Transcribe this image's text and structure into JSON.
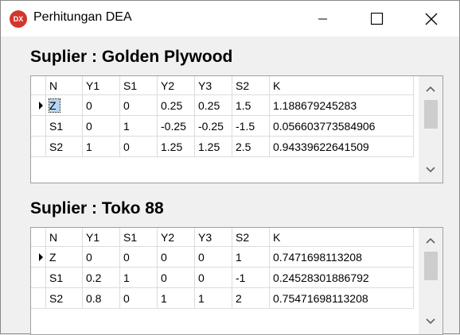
{
  "window": {
    "title": "Perhitungan DEA",
    "icon_text": "DX"
  },
  "sections": [
    {
      "title": "Suplier : Golden Plywood",
      "columns": [
        "N",
        "Y1",
        "S1",
        "Y2",
        "Y3",
        "S2",
        "K"
      ],
      "rows": [
        [
          "Z",
          "0",
          "0",
          "0.25",
          "0.25",
          "1.5",
          "1.188679245283"
        ],
        [
          "S1",
          "0",
          "1",
          "-0.25",
          "-0.25",
          "-1.5",
          "0.056603773584906"
        ],
        [
          "S2",
          "1",
          "0",
          "1.25",
          "1.25",
          "2.5",
          "0.94339622641509"
        ]
      ]
    },
    {
      "title": "Suplier : Toko 88",
      "columns": [
        "N",
        "Y1",
        "S1",
        "Y2",
        "Y3",
        "S2",
        "K"
      ],
      "rows": [
        [
          "Z",
          "0",
          "0",
          "0",
          "0",
          "1",
          "0.7471698113208"
        ],
        [
          "S1",
          "0.2",
          "1",
          "0",
          "0",
          "-1",
          "0.24528301886792"
        ],
        [
          "S2",
          "0.8",
          "0",
          "1",
          "1",
          "2",
          "0.75471698113208"
        ]
      ]
    }
  ]
}
